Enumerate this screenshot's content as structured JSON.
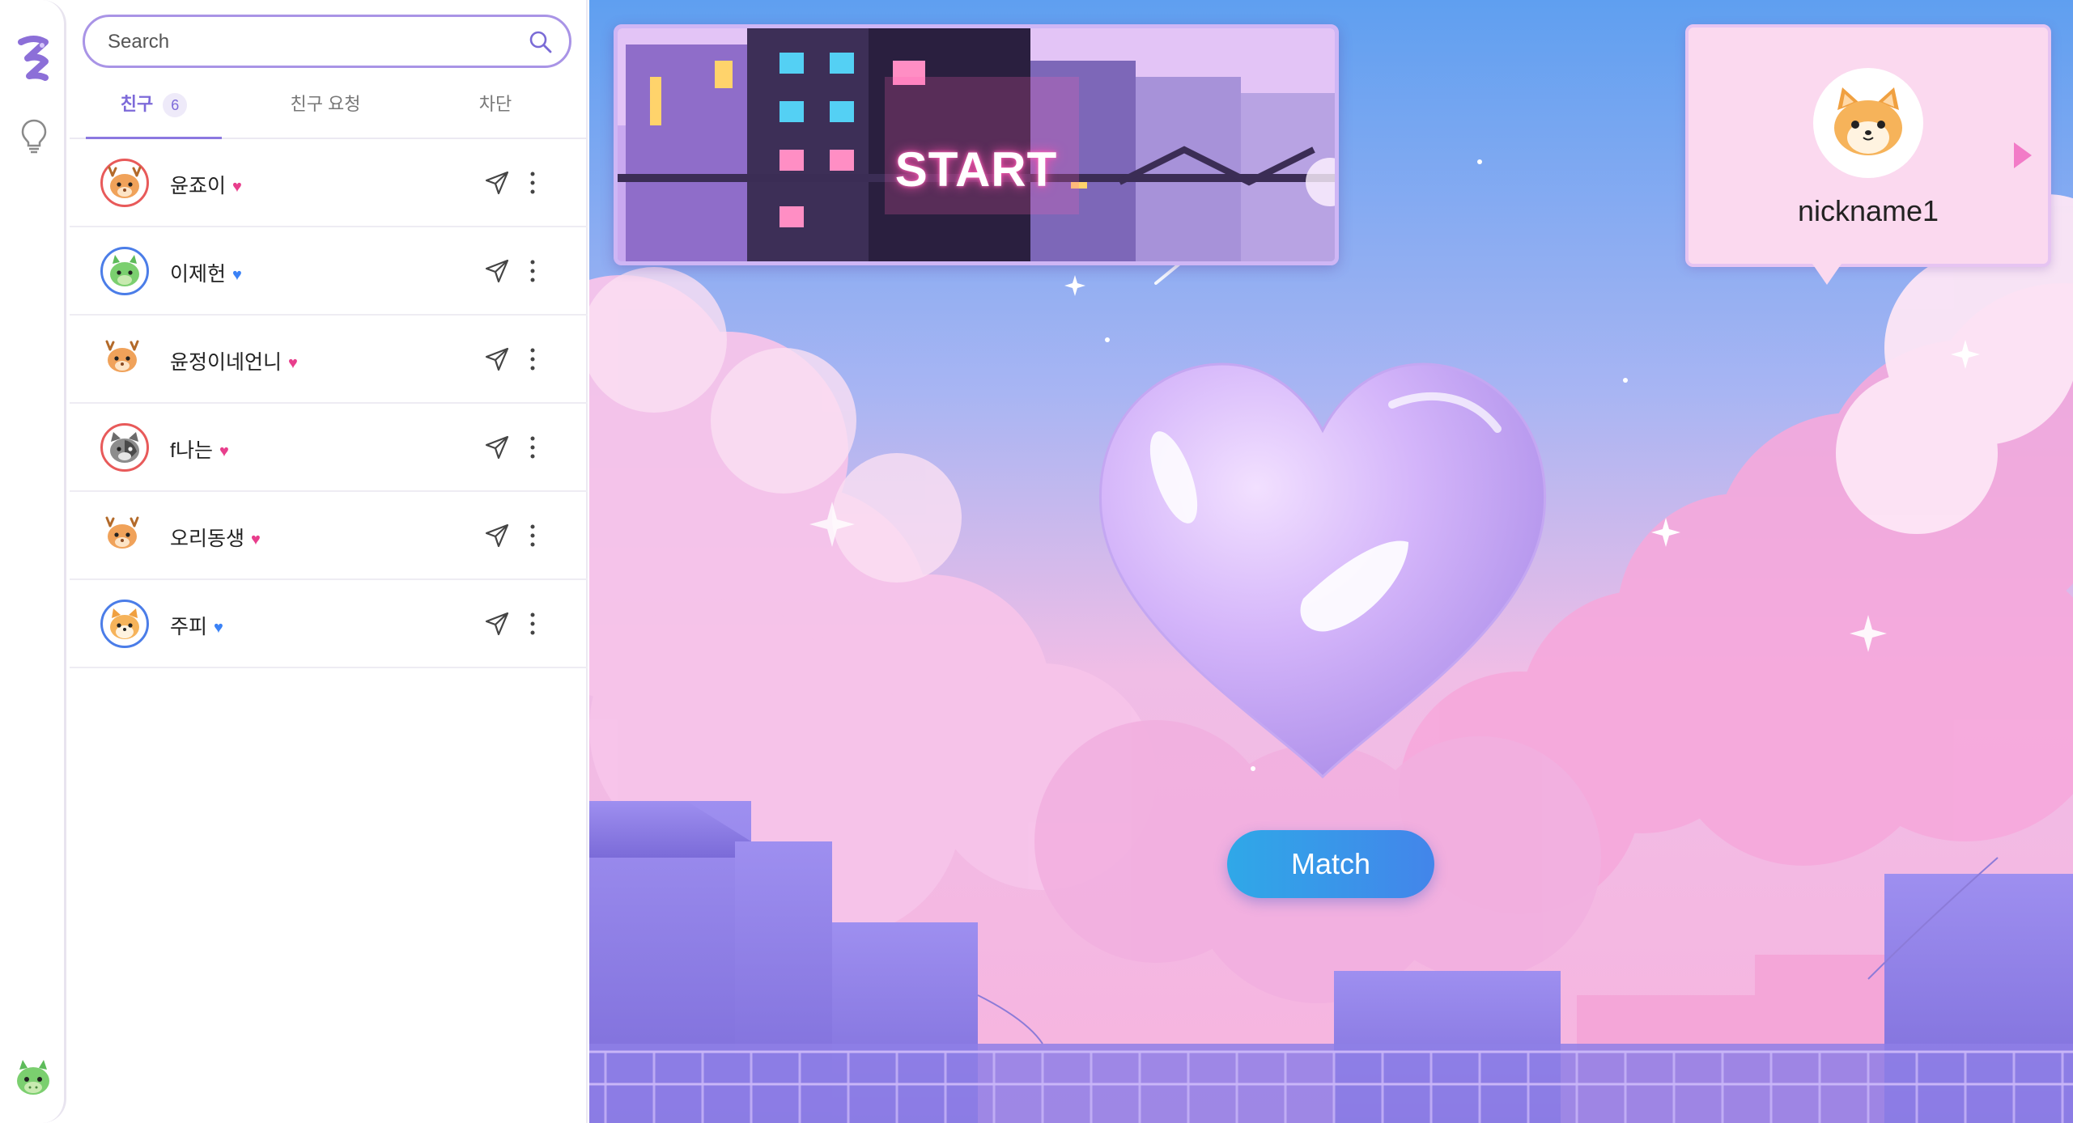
{
  "rail": {
    "logo_icon": "z-logo-icon",
    "tip_icon": "lightbulb-icon",
    "user_icon": "dragon-avatar-icon"
  },
  "search": {
    "placeholder": "Search",
    "icon": "search-icon"
  },
  "tabs": [
    {
      "label": "친구",
      "count": "6",
      "active": true
    },
    {
      "label": "친구 요청",
      "active": false
    },
    {
      "label": "차단",
      "active": false
    }
  ],
  "friends": [
    {
      "name": "윤죠이",
      "heart": "♥",
      "heart_color": "#e83e8c",
      "avatar": "deer-icon",
      "ring": "red"
    },
    {
      "name": "이제헌",
      "heart": "♥",
      "heart_color": "#3b82f6",
      "avatar": "dragon-icon",
      "ring": "blue"
    },
    {
      "name": "윤정이네언니",
      "heart": "♥",
      "heart_color": "#e83e8c",
      "avatar": "deer-icon",
      "ring": "none"
    },
    {
      "name": "f나는",
      "heart": "♥",
      "heart_color": "#e83e8c",
      "avatar": "cat-icon",
      "ring": "red"
    },
    {
      "name": "오리동생",
      "heart": "♥",
      "heart_color": "#e83e8c",
      "avatar": "deer-icon",
      "ring": "none"
    },
    {
      "name": "주피",
      "heart": "♥",
      "heart_color": "#3b82f6",
      "avatar": "shiba-icon",
      "ring": "blue"
    }
  ],
  "scene": {
    "start_label": "START",
    "profile": {
      "nickname": "nickname1",
      "avatar": "shiba-icon"
    },
    "match_label": "Match"
  },
  "colors": {
    "accent": "#8b78e0",
    "heart_pink": "#e83e8c",
    "heart_blue": "#3b82f6",
    "match_button": "#3a95e9"
  }
}
